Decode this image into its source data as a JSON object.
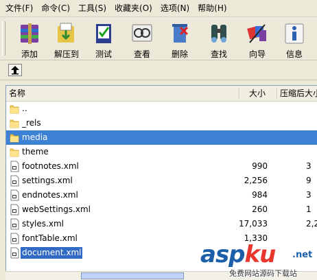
{
  "menu": [
    "文件(F)",
    "命令(C)",
    "工具(S)",
    "收藏夹(O)",
    "选项(N)",
    "帮助(H)"
  ],
  "toolbar": [
    {
      "label": "添加",
      "icon": "add-archive-icon"
    },
    {
      "label": "解压到",
      "icon": "extract-icon"
    },
    {
      "label": "测试",
      "icon": "test-icon"
    },
    {
      "label": "查看",
      "icon": "view-icon"
    },
    {
      "label": "删除",
      "icon": "delete-icon"
    },
    {
      "label": "查找",
      "icon": "find-icon"
    },
    {
      "label": "向导",
      "icon": "wizard-icon"
    },
    {
      "label": "信息",
      "icon": "info-icon"
    }
  ],
  "columns": {
    "name": "名称",
    "size": "大小",
    "packed": "压缩后大小"
  },
  "files": [
    {
      "name": "..",
      "type": "folder",
      "size": "",
      "packed": ""
    },
    {
      "name": "_rels",
      "type": "folder",
      "size": "",
      "packed": ""
    },
    {
      "name": "media",
      "type": "folder",
      "size": "",
      "packed": "",
      "selected": true
    },
    {
      "name": "theme",
      "type": "folder",
      "size": "",
      "packed": ""
    },
    {
      "name": "footnotes.xml",
      "type": "file",
      "size": "990",
      "packed": "3"
    },
    {
      "name": "settings.xml",
      "type": "file",
      "size": "2,256",
      "packed": "9"
    },
    {
      "name": "endnotes.xml",
      "type": "file",
      "size": "984",
      "packed": "3"
    },
    {
      "name": "webSettings.xml",
      "type": "file",
      "size": "260",
      "packed": "1"
    },
    {
      "name": "styles.xml",
      "type": "file",
      "size": "17,033",
      "packed": "2,2"
    },
    {
      "name": "fontTable.xml",
      "type": "file",
      "size": "1,330",
      "packed": ""
    },
    {
      "name": "document.xml",
      "type": "file",
      "size": "",
      "packed": "",
      "selected": true
    }
  ],
  "watermark": {
    "main": "asp",
    "brand": "ku",
    "net": ".net",
    "sub": "免费网站源码下载站"
  },
  "colors": {
    "selection": "#316ac5",
    "window": "#ece9d8"
  }
}
